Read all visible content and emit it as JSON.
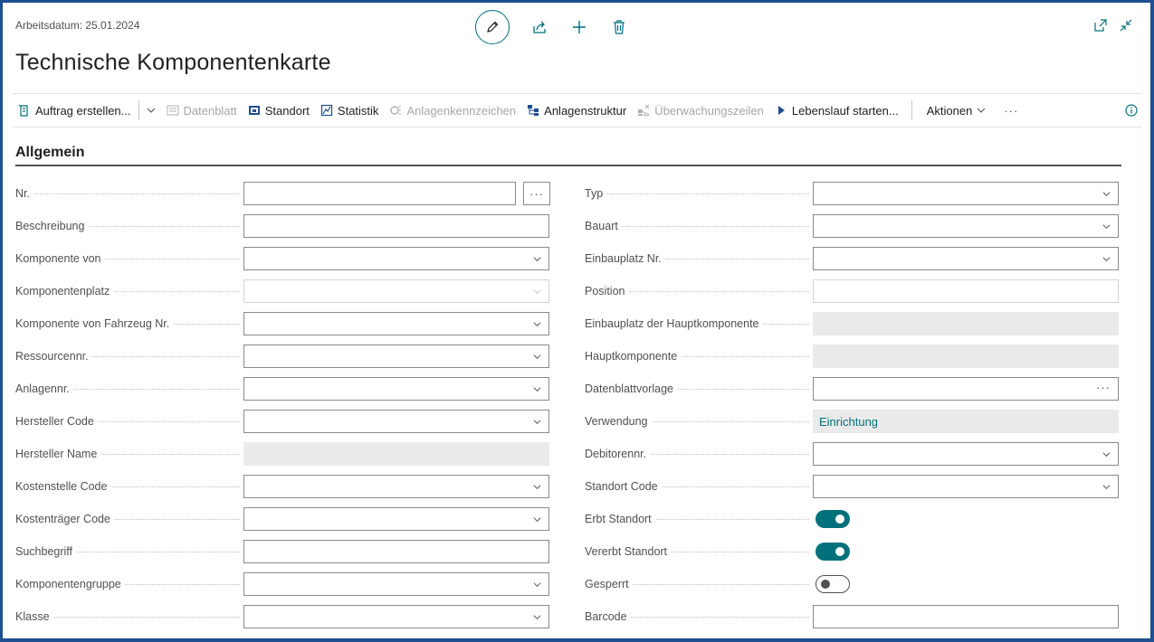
{
  "header": {
    "workdate": "Arbeitsdatum: 25.01.2024",
    "title": "Technische Komponentenkarte",
    "icons": [
      "edit-icon",
      "share-icon",
      "new-icon",
      "delete-icon",
      "open-in-new-window-icon",
      "collapse-icon"
    ]
  },
  "actionbar": {
    "items": [
      {
        "label": "Auftrag erstellen...",
        "icon": "create-order-icon",
        "enabled": true
      },
      {
        "label": "Datenblatt",
        "icon": "datasheet-icon",
        "enabled": false
      },
      {
        "label": "Standort",
        "icon": "location-icon",
        "enabled": true
      },
      {
        "label": "Statistik",
        "icon": "statistics-icon",
        "enabled": true
      },
      {
        "label": "Anlagenkennzeichen",
        "icon": "asset-tag-icon",
        "enabled": false
      },
      {
        "label": "Anlagenstruktur",
        "icon": "asset-structure-icon",
        "enabled": true
      },
      {
        "label": "Überwachungszeilen",
        "icon": "monitoring-icon",
        "enabled": false
      },
      {
        "label": "Lebenslauf starten...",
        "icon": "play-icon",
        "enabled": true
      }
    ],
    "actions_label": "Aktionen",
    "more": "···"
  },
  "section": {
    "title": "Allgemein"
  },
  "left_fields": [
    {
      "label": "Nr.",
      "value": ""
    },
    {
      "label": "Beschreibung",
      "value": ""
    },
    {
      "label": "Komponente von",
      "value": ""
    },
    {
      "label": "Komponentenplatz",
      "value": ""
    },
    {
      "label": "Komponente von Fahrzeug Nr.",
      "value": ""
    },
    {
      "label": "Ressourcennr.",
      "value": ""
    },
    {
      "label": "Anlagennr.",
      "value": ""
    },
    {
      "label": "Hersteller Code",
      "value": ""
    },
    {
      "label": "Hersteller Name",
      "value": ""
    },
    {
      "label": "Kostenstelle Code",
      "value": ""
    },
    {
      "label": "Kostenträger Code",
      "value": ""
    },
    {
      "label": "Suchbegriff",
      "value": ""
    },
    {
      "label": "Komponentengruppe",
      "value": ""
    },
    {
      "label": "Klasse",
      "value": ""
    }
  ],
  "right_fields": [
    {
      "label": "Typ",
      "value": ""
    },
    {
      "label": "Bauart",
      "value": ""
    },
    {
      "label": "Einbauplatz Nr.",
      "value": ""
    },
    {
      "label": "Position",
      "value": ""
    },
    {
      "label": "Einbauplatz der Hauptkomponente",
      "value": ""
    },
    {
      "label": "Hauptkomponente",
      "value": ""
    },
    {
      "label": "Datenblattvorlage",
      "value": ""
    },
    {
      "label": "Verwendung",
      "value": "Einrichtung"
    },
    {
      "label": "Debitorennr.",
      "value": ""
    },
    {
      "label": "Standort Code",
      "value": ""
    },
    {
      "label": "Erbt Standort",
      "value": true
    },
    {
      "label": "Vererbt Standort",
      "value": true
    },
    {
      "label": "Gesperrt",
      "value": false
    },
    {
      "label": "Barcode",
      "value": ""
    }
  ],
  "colors": {
    "accent": "#00717a",
    "frame": "#1e4f8f"
  }
}
